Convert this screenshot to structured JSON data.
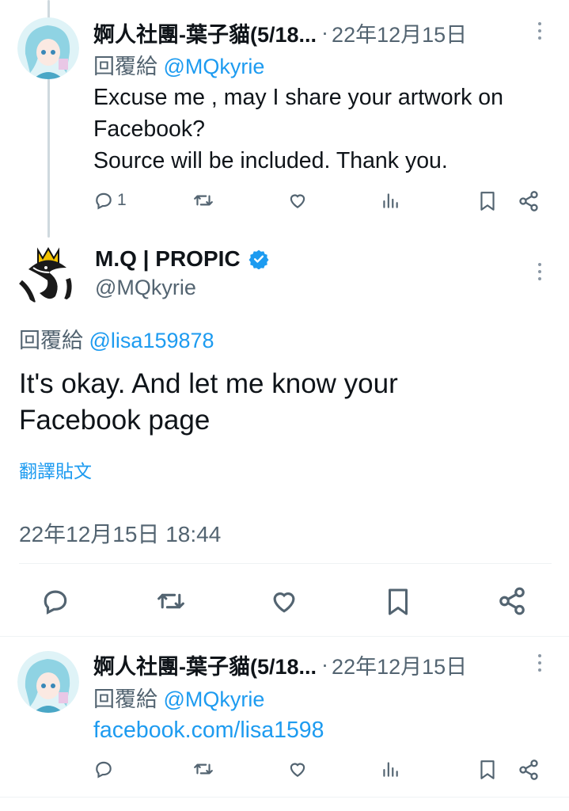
{
  "tweets": [
    {
      "author_name": "婀人社團-葉子貓(5/18...",
      "separator": "·",
      "date": "22年12月15日",
      "reply_prefix": "回覆給",
      "reply_handle": "@MQkyrie",
      "body_lines": [
        "Excuse me , may I share your artwork on",
        "Facebook?",
        "Source will be included. Thank you."
      ],
      "reply_count": "1"
    },
    {
      "author_name": "婀人社團-葉子貓(5/18...",
      "separator": "·",
      "date": "22年12月15日",
      "reply_prefix": "回覆給",
      "reply_handle": "@MQkyrie",
      "link_text": "facebook.com/lisa1598"
    }
  ],
  "main_tweet": {
    "author_name": "M.Q | PROPIC",
    "handle": "@MQkyrie",
    "verified": true,
    "reply_prefix": "回覆給",
    "reply_handle": "@lisa159878",
    "body_lines": [
      "It's okay. And let me know your",
      "Facebook page"
    ],
    "translate_label": "翻譯貼文",
    "timestamp": "22年12月15日 18:44"
  },
  "icons": {
    "reply": "reply-bubble-icon",
    "retweet": "retweet-icon",
    "like": "heart-icon",
    "views": "views-bar-chart-icon",
    "bookmark": "bookmark-icon",
    "share": "share-icon",
    "more": "more-vertical-icon",
    "verified": "verified-badge-icon"
  },
  "colors": {
    "accent": "#1d9bf0",
    "secondary_text": "#536471",
    "primary_text": "#0f1419",
    "divider": "#eff3f4"
  }
}
